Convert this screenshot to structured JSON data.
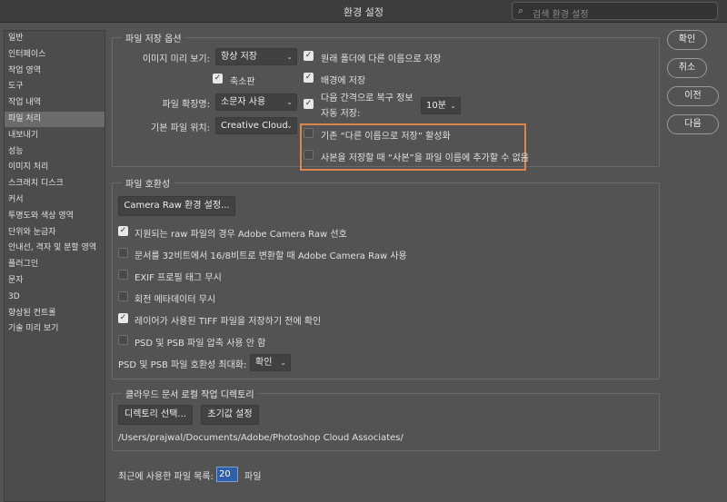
{
  "window": {
    "title": "환경 설정",
    "search_placeholder": "검색 환경 설정",
    "search_icon": "magnifier"
  },
  "sidebar": {
    "items": [
      "일반",
      "인터페이스",
      "작업 영역",
      "도구",
      "작업 내역",
      "파일 처리",
      "내보내기",
      "성능",
      "이미지 처리",
      "스크래치 디스크",
      "커서",
      "투명도와 색상 영역",
      "단위와 눈금자",
      "안내선, 격자 및 분할 영역",
      "플러그인",
      "문자",
      "3D",
      "향상된 컨트롤",
      "기술 미리 보기"
    ],
    "selected": "파일 처리"
  },
  "save_options": {
    "legend": "파일 저장 옵션",
    "image_preview_label": "이미지 미리 보기:",
    "image_preview_value": "항상 저장",
    "thumbnail_label": "축소판",
    "thumbnail_checked": true,
    "extension_label": "파일 확장명:",
    "extension_value": "소문자 사용",
    "default_location_label": "기본 파일 위치:",
    "default_location_value": "Creative Cloud",
    "save_as_original_label": "원래 폴더에 다른 이름으로 저장",
    "save_as_original_checked": true,
    "save_background_label": "배경에 저장",
    "save_background_checked": true,
    "autosave_line1": "다음 간격으로 복구 정보",
    "autosave_line2": "자동 저장:",
    "autosave_checked": true,
    "autosave_interval": "10분",
    "legacy_save_as_label": "기존 “다른 이름으로 저장” 활성화",
    "legacy_save_as_checked": false,
    "no_copy_suffix_label": "사본을 저장할 때 “사본”을 파일 이름에 추가할 수 없음",
    "no_copy_suffix_checked": false
  },
  "compatibility": {
    "legend": "파일 호환성",
    "camera_raw_button": "Camera Raw 환경 설정...",
    "options": [
      {
        "label": "지원되는 raw 파일의 경우 Adobe Camera Raw 선호",
        "checked": true
      },
      {
        "label": "문서를 32비트에서 16/8비트로 변환할 때 Adobe Camera Raw 사용",
        "checked": false
      },
      {
        "label": "EXIF 프로필 태그 무시",
        "checked": false
      },
      {
        "label": "회전 메타데이터 무시",
        "checked": false
      },
      {
        "label": "레이어가 사용된 TIFF 파일을 저장하기 전에 확인",
        "checked": true
      },
      {
        "label": "PSD 및 PSB 파일 압축 사용 안 함",
        "checked": false
      }
    ],
    "maximize_label": "PSD 및 PSB 파일 호환성 최대화:",
    "maximize_value": "확인"
  },
  "cloud": {
    "legend": "클라우드 문서 로컬 작업 디렉토리",
    "choose_button": "디렉토리 선택...",
    "reset_button": "초기값 설정",
    "path": "/Users/prajwal/Documents/Adobe/Photoshop Cloud Associates/"
  },
  "recent": {
    "label": "최근에 사용한 파일 목록:",
    "value": "20",
    "suffix": "파일"
  },
  "buttons": {
    "ok": "확인",
    "cancel": "취소",
    "prev": "이전",
    "next": "다음"
  },
  "colors": {
    "highlight": "#d9864f",
    "selected_input": "#2f5fa8"
  }
}
